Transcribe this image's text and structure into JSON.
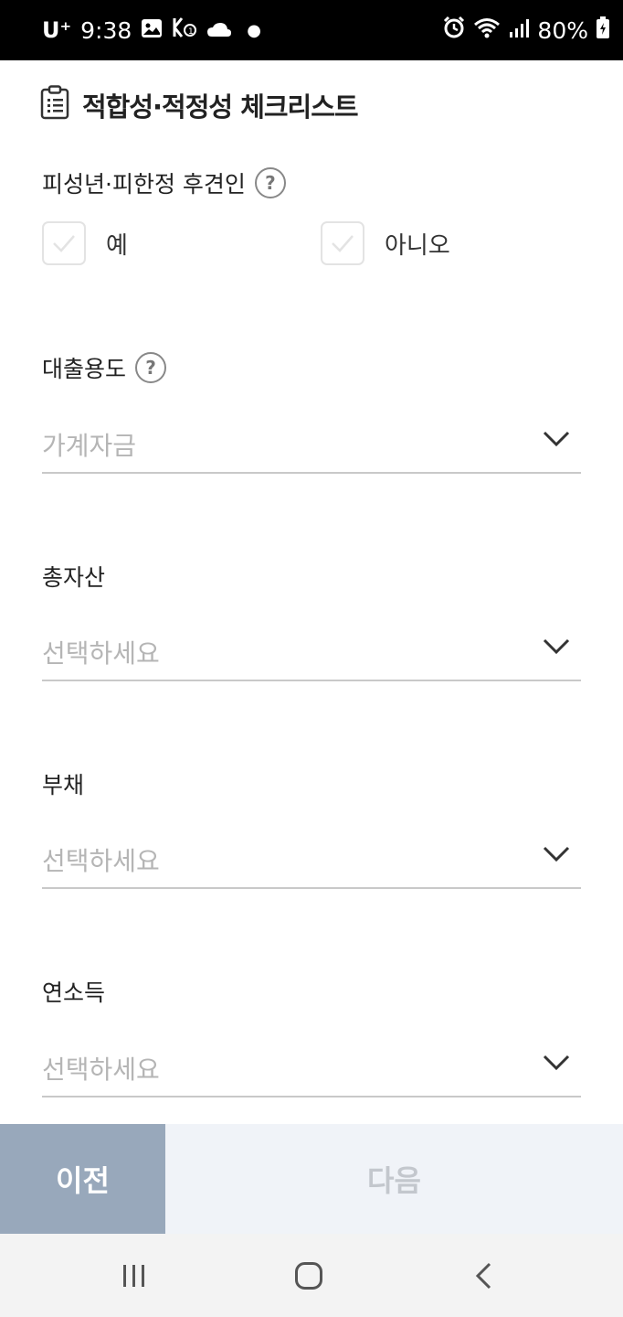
{
  "status_bar": {
    "carrier": "U⁺",
    "time": "9:38",
    "battery": "80%",
    "icons": [
      "image-icon",
      "network-icon",
      "cloud-icon",
      "dot",
      "alarm-icon",
      "wifi-icon",
      "signal-icon",
      "battery-icon"
    ]
  },
  "header": {
    "title": "적합성·적정성 체크리스트",
    "icon": "clipboard-icon"
  },
  "guardian": {
    "label": "피성년·피한정 후견인",
    "help": "?",
    "options": [
      "예",
      "아니오"
    ]
  },
  "loan_purpose": {
    "label": "대출용도",
    "help": "?",
    "value": "가계자금"
  },
  "total_assets": {
    "label": "총자산",
    "placeholder": "선택하세요"
  },
  "liabilities": {
    "label": "부채",
    "placeholder": "선택하세요"
  },
  "annual_income": {
    "label": "연소득",
    "placeholder": "선택하세요"
  },
  "buttons": {
    "prev": "이전",
    "next": "다음"
  },
  "colors": {
    "prev_bg": "#98a8bb",
    "next_bg": "#f0f3f8",
    "placeholder": "#b5b5b5"
  }
}
